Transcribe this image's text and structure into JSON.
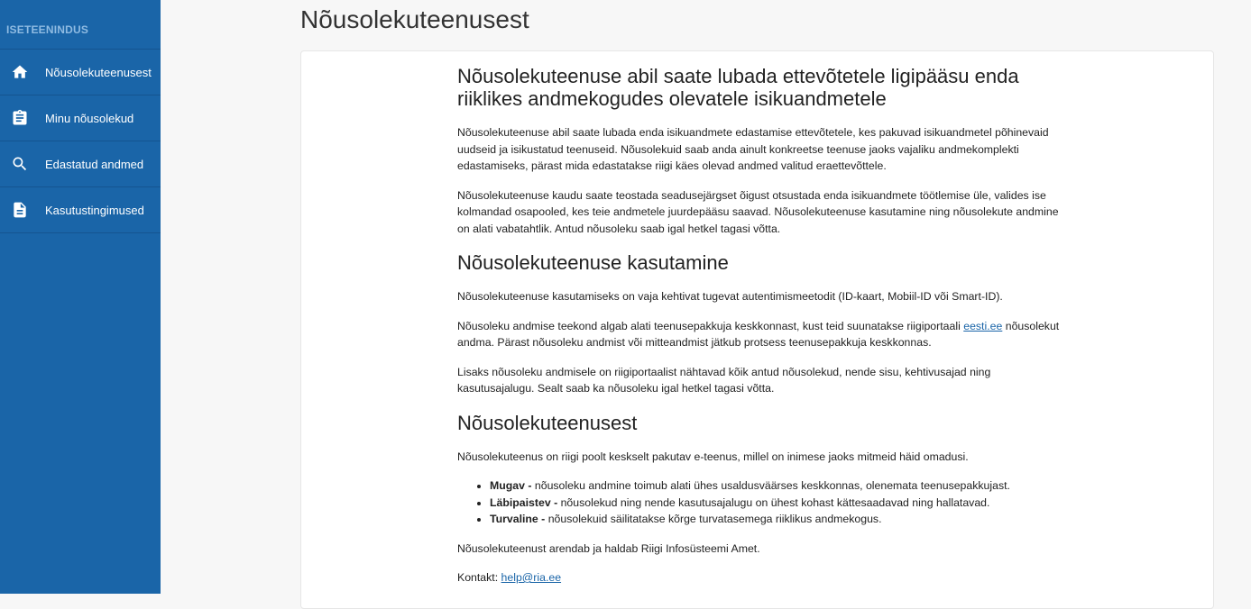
{
  "sidebar": {
    "heading": "ISETEENINDUS",
    "items": [
      {
        "label": "Nõusolekuteenusest",
        "icon": "home-icon"
      },
      {
        "label": "Minu nõusolekud",
        "icon": "clipboard-icon"
      },
      {
        "label": "Edastatud andmed",
        "icon": "search-icon"
      },
      {
        "label": "Kasutustingimused",
        "icon": "document-icon"
      }
    ]
  },
  "page": {
    "title": "Nõusolekuteenusest"
  },
  "content": {
    "heading1": "Nõusolekuteenuse abil saate lubada ettevõtetele ligipääsu enda riiklikes andmekogudes olevatele isikuandmetele",
    "p1": "Nõusolekuteenuse abil saate lubada enda isikuandmete edastamise ettevõtetele, kes pakuvad isikuandmetel põhinevaid uudseid ja isikustatud teenuseid. Nõusolekuid saab anda ainult konkreetse teenuse jaoks vajaliku andmekomplekti edastamiseks, pärast mida edastatakse riigi käes olevad andmed valitud eraettevõttele.",
    "p2": "Nõusolekuteenuse kaudu saate teostada seadusejärgset õigust otsustada enda isikuandmete töötlemise üle, valides ise kolmandad osapooled, kes teie andmetele juurdepääsu saavad. Nõusolekuteenuse kasutamine ning nõusolekute andmine on alati vabatahtlik. Antud nõusoleku saab igal hetkel tagasi võtta.",
    "heading2": "Nõusolekuteenuse kasutamine",
    "p3": "Nõusolekuteenuse kasutamiseks on vaja kehtivat tugevat autentimismeetodit (ID-kaart, Mobiil-ID või Smart-ID).",
    "p4_before": "Nõusoleku andmise teekond algab alati teenusepakkuja keskkonnast, kust teid suunatakse riigiportaali ",
    "p4_link": "eesti.ee",
    "p4_after": " nõusolekut andma. Pärast nõusoleku andmist või mitteandmist jätkub protsess teenusepakkuja keskkonnas.",
    "p5": "Lisaks nõusoleku andmisele on riigiportaalist nähtavad kõik antud nõusolekud, nende sisu, kehtivusajad ning kasutusajalugu. Sealt saab ka nõusoleku igal hetkel tagasi võtta.",
    "heading3": "Nõusolekuteenusest",
    "p6": "Nõusolekuteenus on riigi poolt keskselt pakutav e-teenus, millel on inimese jaoks mitmeid häid omadusi.",
    "features": [
      {
        "term": "Mugav -",
        "text": " nõusoleku andmine toimub alati ühes usaldusväärses keskkonnas, olenemata teenusepakkujast."
      },
      {
        "term": "Läbipaistev -",
        "text": " nõusolekud ning nende kasutusajalugu on ühest kohast kättesaadavad ning hallatavad."
      },
      {
        "term": "Turvaline -",
        "text": " nõusolekuid säilitatakse kõrge turvatasemega riiklikus andmekogus."
      }
    ],
    "p7": "Nõusolekuteenust arendab ja haldab Riigi Infosüsteemi Amet.",
    "contact_label": "Kontakt: ",
    "contact_link": "help@ria.ee"
  }
}
